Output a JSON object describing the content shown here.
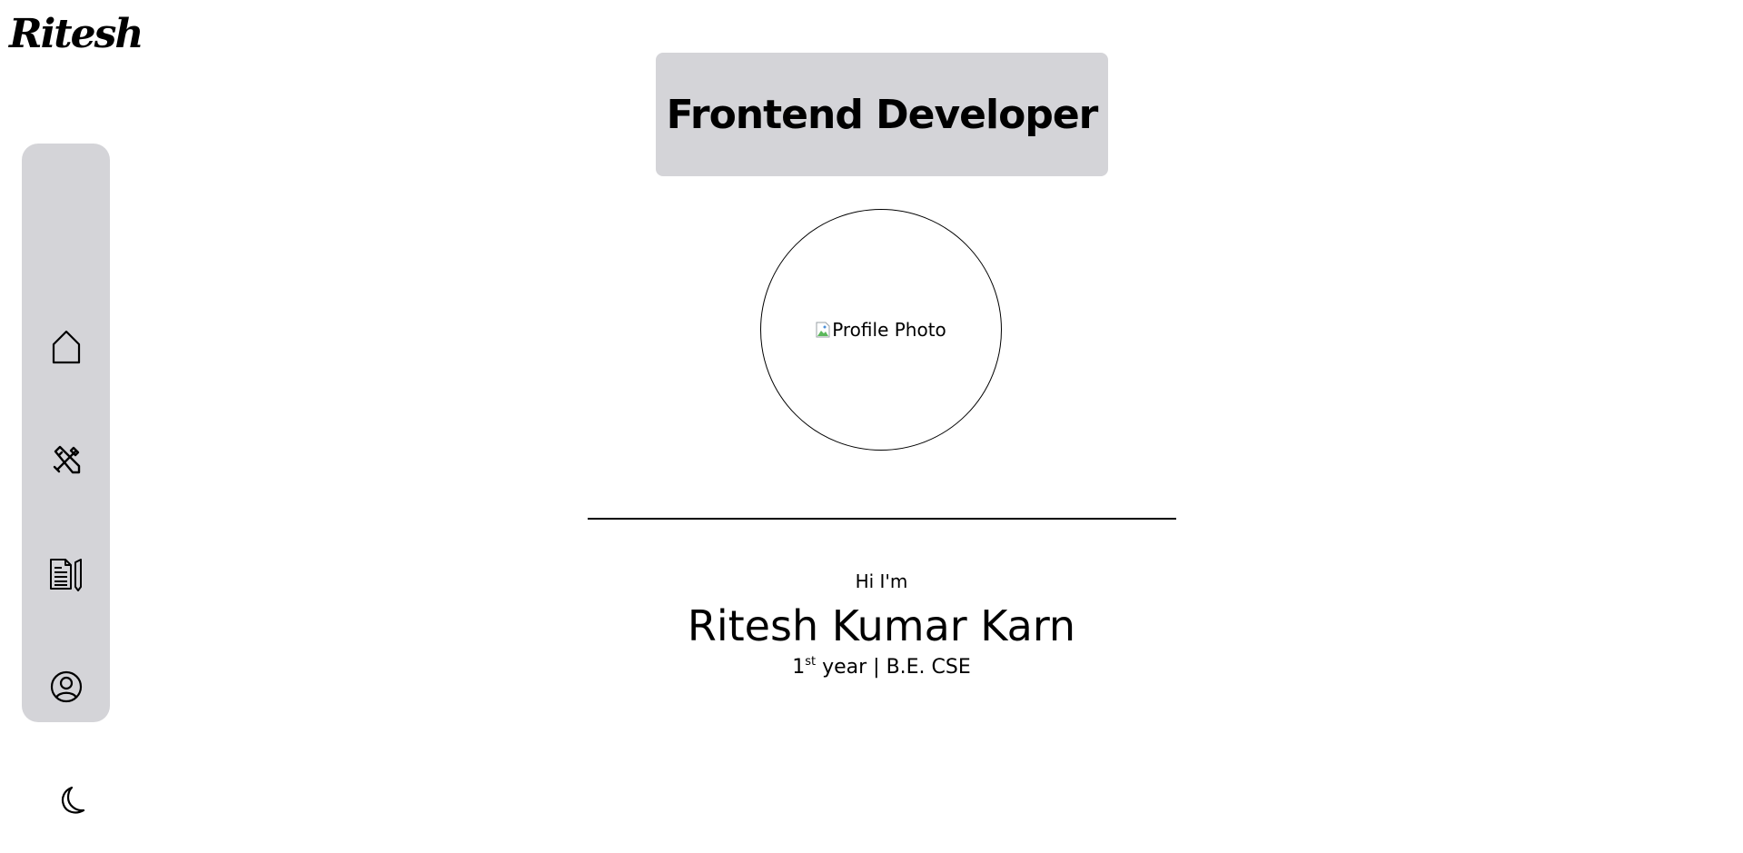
{
  "header": {
    "logo_text": "Ritesh"
  },
  "sidebar": {
    "items": [
      {
        "icon": "home-icon",
        "label": "Home"
      },
      {
        "icon": "tools-icon",
        "label": "Skills"
      },
      {
        "icon": "document-icon",
        "label": "Resume"
      },
      {
        "icon": "user-circle-icon",
        "label": "About"
      },
      {
        "icon": "moon-icon",
        "label": "Theme toggle"
      }
    ]
  },
  "hero": {
    "role_title": "Frontend Developer",
    "avatar_alt": "Profile Photo",
    "greeting": "Hi I'm",
    "name": "Ritesh Kumar Karn",
    "year_number": "1",
    "year_suffix": "st",
    "year_rest": " year | B.E. CSE"
  },
  "colors": {
    "panel_bg": "#d4d4d8",
    "text": "#000000",
    "background": "#ffffff"
  }
}
